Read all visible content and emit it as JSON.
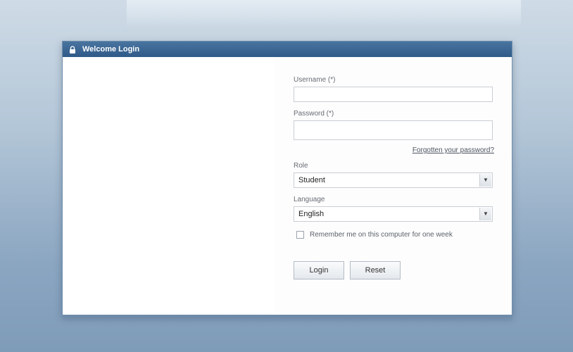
{
  "window": {
    "title": "Welcome Login",
    "icon": "lock-icon"
  },
  "form": {
    "username_label": "Username (*)",
    "username_value": "",
    "password_label": "Password (*)",
    "password_value": "",
    "forgot_link": "Forgotten your password?",
    "role_label": "Role",
    "role_selected": "Student",
    "language_label": "Language",
    "language_selected": "English",
    "remember_label": "Remember me on this computer for one week",
    "remember_checked": false,
    "login_button": "Login",
    "reset_button": "Reset"
  },
  "colors": {
    "titlebar": "#2f5a88",
    "background_top": "#cfdbe6",
    "background_bottom": "#7e9bb8"
  }
}
